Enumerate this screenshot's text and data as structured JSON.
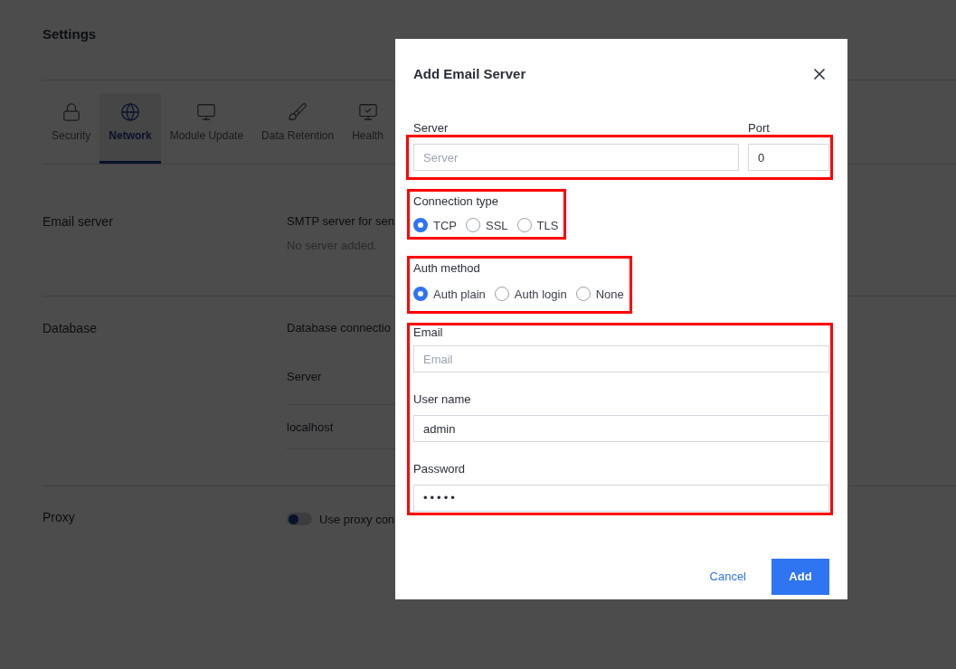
{
  "page": {
    "title": "Settings",
    "tabs": [
      {
        "label": "Security",
        "selected": false
      },
      {
        "label": "Network",
        "selected": true
      },
      {
        "label": "Module Update",
        "selected": false
      },
      {
        "label": "Data Retention",
        "selected": false
      },
      {
        "label": "Health",
        "selected": false
      }
    ],
    "email_section": {
      "title": "Email server",
      "description": "SMTP server for sen",
      "note": "No server added."
    },
    "database_section": {
      "title": "Database",
      "description": "Database connectio",
      "table": {
        "columns": [
          "Server"
        ],
        "rows": [
          [
            "localhost"
          ]
        ]
      }
    },
    "proxy_section": {
      "title": "Proxy",
      "toggle": {
        "label": "Use proxy con",
        "on": false
      }
    }
  },
  "dialog": {
    "title": "Add Email Server",
    "server": {
      "label": "Server",
      "placeholder": "Server"
    },
    "port": {
      "label": "Port",
      "value": "0"
    },
    "connection_type": {
      "label": "Connection type",
      "options": [
        {
          "label": "TCP",
          "selected": true
        },
        {
          "label": "SSL",
          "selected": false
        },
        {
          "label": "TLS",
          "selected": false
        }
      ]
    },
    "auth_method": {
      "label": "Auth method",
      "options": [
        {
          "label": "Auth plain",
          "selected": true
        },
        {
          "label": "Auth login",
          "selected": false
        },
        {
          "label": "None",
          "selected": false
        }
      ]
    },
    "email": {
      "label": "Email",
      "placeholder": "Email"
    },
    "user_name": {
      "label": "User name",
      "value": "admin"
    },
    "password": {
      "label": "Password",
      "value": "•••••"
    },
    "buttons": {
      "cancel": "Cancel",
      "add": "Add"
    }
  }
}
